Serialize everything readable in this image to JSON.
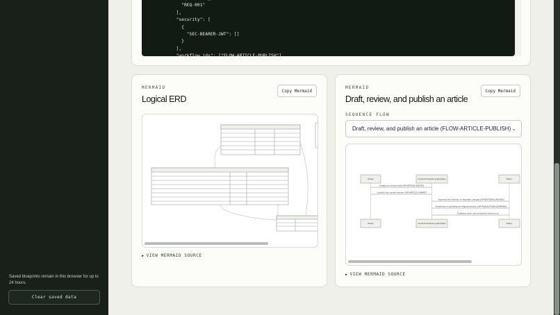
{
  "sidebar": {
    "note": "Saved blueprints remain in this browser for up to 24 hours.",
    "clear_label": "Clear saved data"
  },
  "code": {
    "lines": "  \"requirement_ids\": [\n    \"REQ-001\"\n  ],\n  \"security\": [\n    {\n      \"SEC-BEARER-JWT\": []\n    }\n  ],\n  \"workflow_ids\": [\"FLOW-ARTICLE-PUBLISH\"]"
  },
  "cards": [
    {
      "eyebrow": "MERMAID",
      "title": "Logical ERD",
      "copy_label": "Copy Mermaid",
      "source_toggle": "VIEW MERMAID SOURCE"
    },
    {
      "eyebrow": "MERMAID",
      "title": "Draft, review, and publish an article",
      "copy_label": "Copy Mermaid",
      "select_label": "SEQUENCE FLOW",
      "select_value": "Draft, review, and publish an article (FLOW-ARTICLE-PUBLISH)",
      "source_toggle": "VIEW MERMAID SOURCE",
      "participants": [
        "Writer",
        "Content Publishing Workflow",
        "Editor"
      ],
      "messages": [
        "Creates an article draft [API-ARTICLE-CREATE]",
        "Submits the current revision [API-ARTICLE-SUBMIT]",
        "Approves the revision or requests changes [API-EDITORIAL-REVIEW]",
        "Schedules or publishes an eligible revision [API-PUBLICATION-COMMAND]",
        "Publishes each due scheduled article once"
      ]
    }
  ],
  "colors": {
    "sidebar": "#182019",
    "page": "#eef0e9",
    "card": "#fcfcf9"
  }
}
